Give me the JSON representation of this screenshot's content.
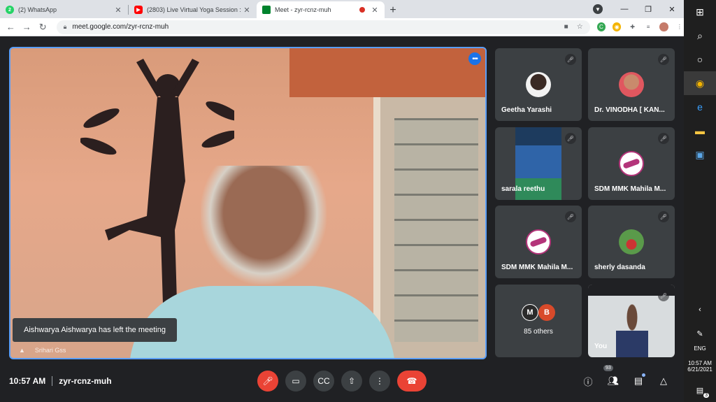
{
  "browser": {
    "tabs": [
      {
        "title": "(2) WhatsApp",
        "icon": "whatsapp-icon",
        "color": "#25d366",
        "badge": "2"
      },
      {
        "title": "(2803) Live Virtual Yoga Session :",
        "icon": "youtube-icon",
        "color": "#ff0000"
      },
      {
        "title": "Meet - zyr-rcnz-muh",
        "icon": "meet-icon",
        "color": "#00832d",
        "active": true
      }
    ],
    "url": "meet.google.com/zyr-rcnz-muh"
  },
  "main_video": {
    "toast": "Aishwarya Aishwarya has left the meeting",
    "speaker": "Srihari Gss"
  },
  "participants": [
    {
      "name": "Geetha Yarashi",
      "avatar": "photo"
    },
    {
      "name": "Dr. VINODHA [ KAN...",
      "avatar": "photo"
    },
    {
      "name": "sarala reethu",
      "avatar": "video"
    },
    {
      "name": "SDM MMK Mahila M...",
      "avatar": "logo"
    },
    {
      "name": "SDM MMK Mahila M...",
      "avatar": "logo"
    },
    {
      "name": "sherly dasanda",
      "avatar": "photo"
    }
  ],
  "others": {
    "label": "85 others",
    "initials": [
      "M",
      "B"
    ]
  },
  "self_tile": {
    "name": "You"
  },
  "bottom_bar": {
    "time": "10:57 AM",
    "meeting_code": "zyr-rcnz-muh",
    "people_count": "93"
  },
  "taskbar": {
    "lang": "ENG",
    "time": "10:57 AM",
    "date": "6/21/2021",
    "notif": "3"
  }
}
